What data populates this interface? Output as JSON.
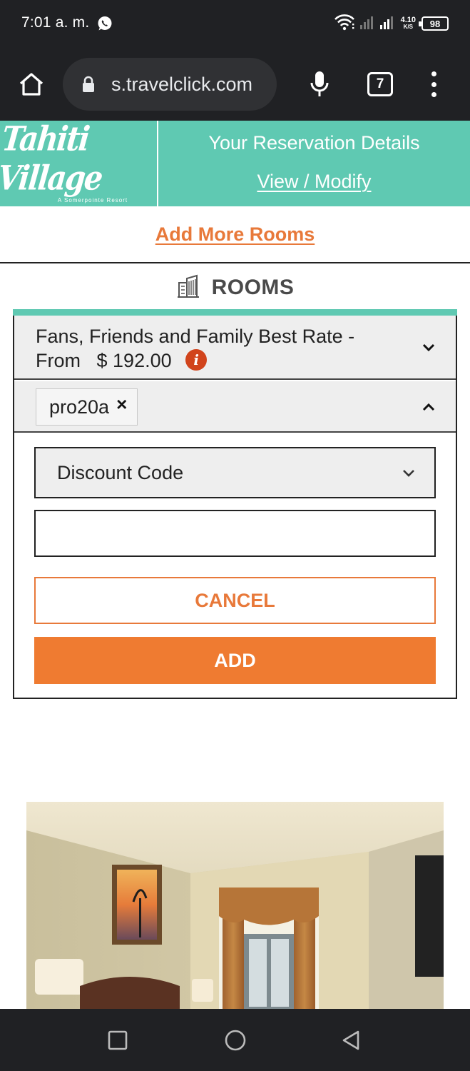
{
  "status_bar": {
    "time": "7:01 a. m.",
    "net_speed_value": "4.10",
    "net_speed_unit": "K/S",
    "battery": "98"
  },
  "browser": {
    "url": "s.travelclick.com",
    "tab_count": "7"
  },
  "header": {
    "logo_text": "Tahiti Village",
    "logo_subtext": "A Somerpointe Resort",
    "reservation_title": "Your Reservation Details",
    "view_modify_link": "View / Modify",
    "brand_color": "#5fc9b2"
  },
  "add_more_rooms_link": "Add More Rooms",
  "rooms": {
    "heading": "ROOMS",
    "rate_name": "Fans, Friends and Family Best Rate -",
    "rate_prefix": "From",
    "rate_price": "$ 192.00",
    "applied_code": "pro20a",
    "code_type_select": "Discount Code",
    "code_input_value": "",
    "cancel_label": "CANCEL",
    "add_label": "ADD",
    "accent_color": "#ef7b31"
  },
  "icons": {
    "status": [
      "whatsapp-icon",
      "wifi-icon",
      "signal-icon",
      "battery-icon"
    ],
    "browser": [
      "home-icon",
      "lock-icon",
      "mic-icon",
      "tabs-icon",
      "more-vert-icon"
    ],
    "rooms": [
      "building-icon",
      "info-icon",
      "chevron-down-icon",
      "chevron-up-icon",
      "close-icon"
    ],
    "nav": [
      "recents-icon",
      "home-circle-icon",
      "back-icon"
    ]
  }
}
